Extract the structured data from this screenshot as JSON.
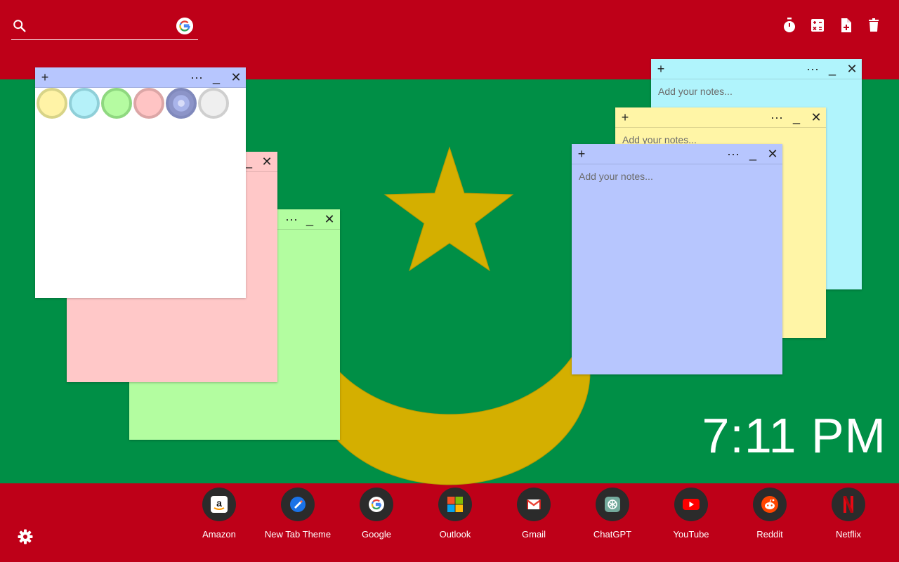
{
  "search": {
    "placeholder": "",
    "value": ""
  },
  "clock": {
    "time": "7:11 PM"
  },
  "notes": {
    "placeholder": "Add your notes...",
    "add_label": "+",
    "menu_label": "···",
    "minimize_label": "_",
    "close_label": "✕"
  },
  "swatch_colors": [
    "#fff3a6",
    "#b5f1f9",
    "#b5fba1",
    "#ffc4c4",
    "#a9b4ea",
    "#efefef"
  ],
  "dock": [
    {
      "label": "Amazon",
      "icon": "amazon-icon"
    },
    {
      "label": "New Tab Theme",
      "icon": "new-tab-theme-icon"
    },
    {
      "label": "Google",
      "icon": "google-icon"
    },
    {
      "label": "Outlook",
      "icon": "outlook-icon"
    },
    {
      "label": "Gmail",
      "icon": "gmail-icon"
    },
    {
      "label": "ChatGPT",
      "icon": "chatgpt-icon"
    },
    {
      "label": "YouTube",
      "icon": "youtube-icon"
    },
    {
      "label": "Reddit",
      "icon": "reddit-icon"
    },
    {
      "label": "Netflix",
      "icon": "netflix-icon"
    }
  ],
  "colors": {
    "flag_red": "#be0018",
    "flag_green": "#008f46",
    "emblem_gold": "#d4af00",
    "note_white": "#ffffff",
    "note_pink": "#ffc8c8",
    "note_green": "#b3fda0",
    "note_cyan": "#b0f4fc",
    "note_yellow": "#fff5a6",
    "note_blue": "#b7c6fe"
  }
}
